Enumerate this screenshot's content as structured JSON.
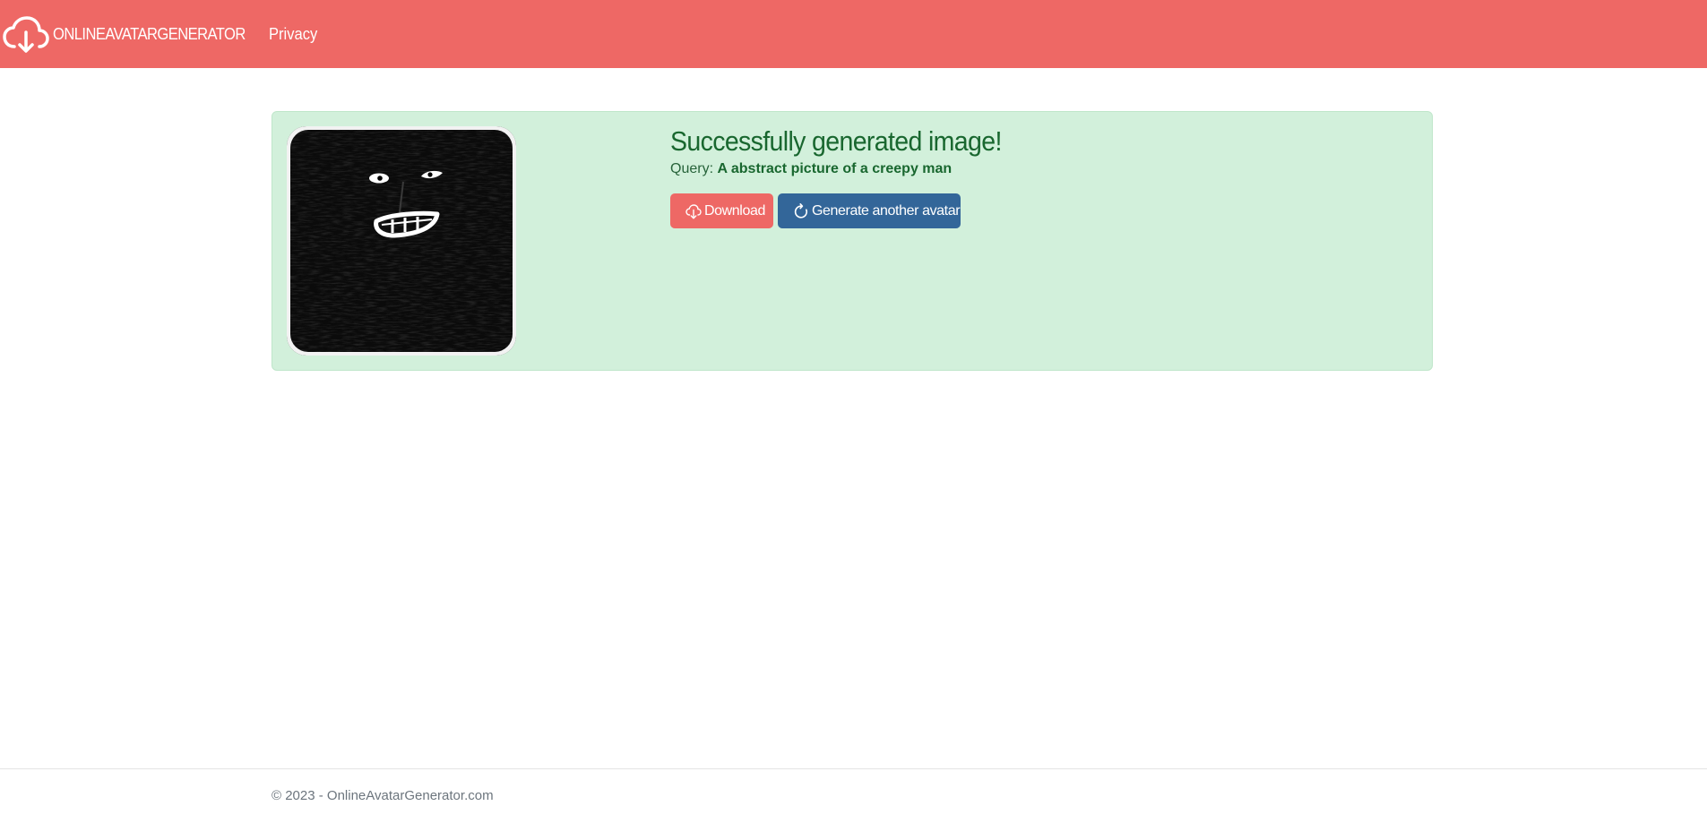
{
  "navbar": {
    "brand": "ONLINEAVATARGENERATOR",
    "links": [
      {
        "label": "Privacy"
      }
    ],
    "background": "#ee6865"
  },
  "result": {
    "title": "Successfully generated image!",
    "query_label": "Query:",
    "query_value": "A abstract picture of a creepy man",
    "background": "#d2f0db",
    "buttons": {
      "download": {
        "label": "Download",
        "icon": "cloud-download-icon",
        "color": "#ee6865"
      },
      "generate": {
        "label": "Generate another avatar",
        "icon": "refresh-icon",
        "color": "#336699"
      }
    }
  },
  "footer": {
    "text": "© 2023 - OnlineAvatarGenerator.com"
  }
}
